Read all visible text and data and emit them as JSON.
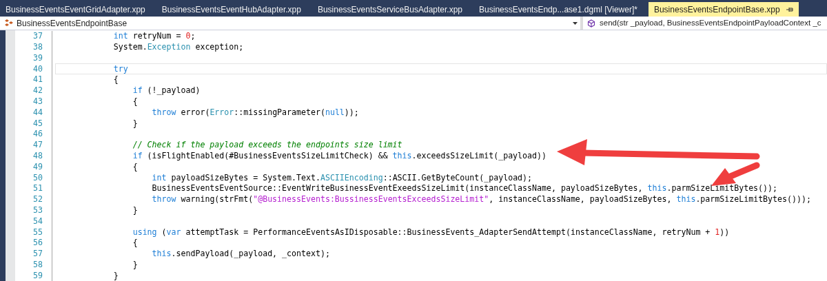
{
  "tabs": [
    {
      "label": "BusinessEventsEventGridAdapter.xpp",
      "selected": false
    },
    {
      "label": "BusinessEventsEventHubAdapter.xpp",
      "selected": false
    },
    {
      "label": "BusinessEventsServiceBusAdapter.xpp",
      "selected": false
    },
    {
      "label": "BusinessEventsEndp...ase1.dgml [Viewer]*",
      "selected": false
    },
    {
      "label": "BusinessEventsEndpointBase.xpp",
      "selected": true
    }
  ],
  "navigation": {
    "class_dropdown": "BusinessEventsEndpointBase",
    "member_dropdown": "send(str _payload, BusinessEventsEndpointPayloadContext _c"
  },
  "code_lines": [
    {
      "number": "37",
      "current": false,
      "tokens": [
        {
          "kind": "keyword",
          "text": "            int"
        },
        {
          "kind": "plain",
          "text": " retryNum = "
        },
        {
          "kind": "number",
          "text": "0"
        },
        {
          "kind": "plain",
          "text": ";"
        }
      ]
    },
    {
      "number": "38",
      "current": false,
      "tokens": [
        {
          "kind": "plain",
          "text": "            System."
        },
        {
          "kind": "type",
          "text": "Exception"
        },
        {
          "kind": "plain",
          "text": " exception;"
        }
      ]
    },
    {
      "number": "39",
      "current": false
    },
    {
      "number": "40",
      "current": true,
      "tokens": [
        {
          "kind": "keyword",
          "text": "            try"
        }
      ]
    },
    {
      "number": "41",
      "current": false,
      "tokens": [
        {
          "kind": "plain",
          "text": "            {"
        }
      ]
    },
    {
      "number": "42",
      "current": false,
      "tokens": [
        {
          "kind": "keyword",
          "text": "                if"
        },
        {
          "kind": "plain",
          "text": " (!_payload)"
        }
      ]
    },
    {
      "number": "43",
      "current": false,
      "tokens": [
        {
          "kind": "plain",
          "text": "                {"
        }
      ]
    },
    {
      "number": "44",
      "current": false,
      "tokens": [
        {
          "kind": "keyword",
          "text": "                    throw"
        },
        {
          "kind": "plain",
          "text": " error("
        },
        {
          "kind": "type",
          "text": "Error"
        },
        {
          "kind": "plain",
          "text": "::missingParameter("
        },
        {
          "kind": "keyword",
          "text": "null"
        },
        {
          "kind": "plain",
          "text": "));"
        }
      ]
    },
    {
      "number": "45",
      "current": false,
      "tokens": [
        {
          "kind": "plain",
          "text": "                }"
        }
      ]
    },
    {
      "number": "46",
      "current": false
    },
    {
      "number": "47",
      "current": false,
      "tokens": [
        {
          "kind": "comment",
          "text": "                // Check if the payload exceeds the endpoints size limit"
        }
      ]
    },
    {
      "number": "48",
      "current": false,
      "tokens": [
        {
          "kind": "keyword",
          "text": "                if"
        },
        {
          "kind": "plain",
          "text": " (isFlightEnabled(#BusinessEventsSizeLimitCheck) && "
        },
        {
          "kind": "keyword",
          "text": "this"
        },
        {
          "kind": "plain",
          "text": ".exceedsSizeLimit(_payload))"
        }
      ]
    },
    {
      "number": "49",
      "current": false,
      "tokens": [
        {
          "kind": "plain",
          "text": "                {"
        }
      ]
    },
    {
      "number": "50",
      "current": false,
      "tokens": [
        {
          "kind": "keyword",
          "text": "                    int"
        },
        {
          "kind": "plain",
          "text": " payloadSizeBytes = System.Text."
        },
        {
          "kind": "type",
          "text": "ASCIIEncoding"
        },
        {
          "kind": "plain",
          "text": "::ASCII.GetByteCount(_payload);"
        }
      ]
    },
    {
      "number": "51",
      "current": false,
      "tokens": [
        {
          "kind": "plain",
          "text": "                    BusinessEventsEventSource::EventWriteBusinessEventExeedsSizeLimit(instanceClassName, payloadSizeBytes, "
        },
        {
          "kind": "keyword",
          "text": "this"
        },
        {
          "kind": "plain",
          "text": ".parmSizeLimitBytes());"
        }
      ]
    },
    {
      "number": "52",
      "current": false,
      "tokens": [
        {
          "kind": "keyword",
          "text": "                    throw"
        },
        {
          "kind": "plain",
          "text": " warning(strFmt("
        },
        {
          "kind": "string",
          "text": "\"@BusinessEvents:BussinessEventsExceedsSizeLimit\""
        },
        {
          "kind": "plain",
          "text": ", instanceClassName, payloadSizeBytes, "
        },
        {
          "kind": "keyword",
          "text": "this"
        },
        {
          "kind": "plain",
          "text": ".parmSizeLimitBytes()));"
        }
      ]
    },
    {
      "number": "53",
      "current": false,
      "tokens": [
        {
          "kind": "plain",
          "text": "                }"
        }
      ]
    },
    {
      "number": "54",
      "current": false
    },
    {
      "number": "55",
      "current": false,
      "tokens": [
        {
          "kind": "keyword",
          "text": "                using"
        },
        {
          "kind": "plain",
          "text": " ("
        },
        {
          "kind": "keyword",
          "text": "var"
        },
        {
          "kind": "plain",
          "text": " attemptTask = PerformanceEventsAsIDisposable::BusinessEvents_AdapterSendAttempt(instanceClassName, retryNum + "
        },
        {
          "kind": "number",
          "text": "1"
        },
        {
          "kind": "plain",
          "text": "))"
        }
      ]
    },
    {
      "number": "56",
      "current": false,
      "tokens": [
        {
          "kind": "plain",
          "text": "                {"
        }
      ]
    },
    {
      "number": "57",
      "current": false,
      "tokens": [
        {
          "kind": "keyword",
          "text": "                    this"
        },
        {
          "kind": "plain",
          "text": ".sendPayload(_payload, _context);"
        }
      ]
    },
    {
      "number": "58",
      "current": false,
      "tokens": [
        {
          "kind": "plain",
          "text": "                }"
        }
      ]
    },
    {
      "number": "59",
      "current": false,
      "tokens": [
        {
          "kind": "plain",
          "text": "            }"
        }
      ]
    }
  ]
}
